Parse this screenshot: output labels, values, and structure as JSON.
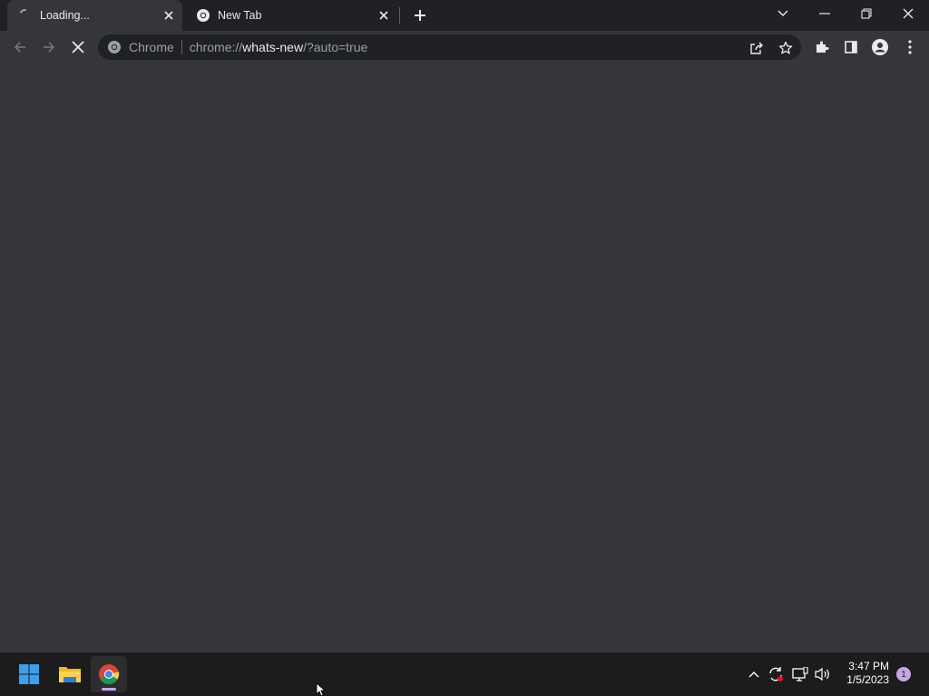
{
  "tabs": [
    {
      "title": "Loading...",
      "state": "loading"
    },
    {
      "title": "New Tab",
      "state": "idle"
    }
  ],
  "omnibox": {
    "chip": "Chrome",
    "url_prefix": "chrome://",
    "url_host": "whats-new",
    "url_suffix": "/?auto=true"
  },
  "taskbar": {
    "apps": [
      "windows-start",
      "file-explorer",
      "google-chrome"
    ],
    "active_app": "google-chrome"
  },
  "clock": {
    "time": "3:47 PM",
    "date": "1/5/2023"
  },
  "notifications": {
    "count": "1"
  },
  "colors": {
    "frame": "#202124",
    "toolbar": "#35363a",
    "accent": "#c6a6e8",
    "text": "#e8eaed"
  }
}
